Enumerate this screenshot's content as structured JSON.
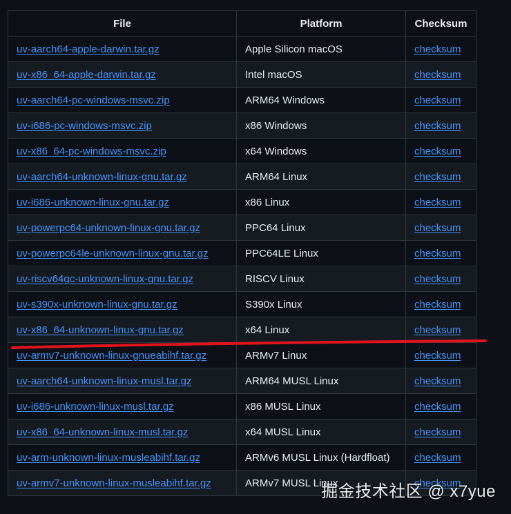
{
  "headers": {
    "file": "File",
    "platform": "Platform",
    "checksum": "Checksum"
  },
  "rows": [
    {
      "file": "uv-aarch64-apple-darwin.tar.gz",
      "platform": "Apple Silicon macOS",
      "checksum": "checksum"
    },
    {
      "file": "uv-x86_64-apple-darwin.tar.gz",
      "platform": "Intel macOS",
      "checksum": "checksum"
    },
    {
      "file": "uv-aarch64-pc-windows-msvc.zip",
      "platform": "ARM64 Windows",
      "checksum": "checksum"
    },
    {
      "file": "uv-i686-pc-windows-msvc.zip",
      "platform": "x86 Windows",
      "checksum": "checksum"
    },
    {
      "file": "uv-x86_64-pc-windows-msvc.zip",
      "platform": "x64 Windows",
      "checksum": "checksum"
    },
    {
      "file": "uv-aarch64-unknown-linux-gnu.tar.gz",
      "platform": "ARM64 Linux",
      "checksum": "checksum"
    },
    {
      "file": "uv-i686-unknown-linux-gnu.tar.gz",
      "platform": "x86 Linux",
      "checksum": "checksum"
    },
    {
      "file": "uv-powerpc64-unknown-linux-gnu.tar.gz",
      "platform": "PPC64 Linux",
      "checksum": "checksum"
    },
    {
      "file": "uv-powerpc64le-unknown-linux-gnu.tar.gz",
      "platform": "PPC64LE Linux",
      "checksum": "checksum"
    },
    {
      "file": "uv-riscv64gc-unknown-linux-gnu.tar.gz",
      "platform": "RISCV Linux",
      "checksum": "checksum"
    },
    {
      "file": "uv-s390x-unknown-linux-gnu.tar.gz",
      "platform": "S390x Linux",
      "checksum": "checksum"
    },
    {
      "file": "uv-x86_64-unknown-linux-gnu.tar.gz",
      "platform": "x64 Linux",
      "checksum": "checksum"
    },
    {
      "file": "uv-armv7-unknown-linux-gnueabihf.tar.gz",
      "platform": "ARMv7 Linux",
      "checksum": "checksum"
    },
    {
      "file": "uv-aarch64-unknown-linux-musl.tar.gz",
      "platform": "ARM64 MUSL Linux",
      "checksum": "checksum"
    },
    {
      "file": "uv-i686-unknown-linux-musl.tar.gz",
      "platform": "x86 MUSL Linux",
      "checksum": "checksum"
    },
    {
      "file": "uv-x86_64-unknown-linux-musl.tar.gz",
      "platform": "x64 MUSL Linux",
      "checksum": "checksum"
    },
    {
      "file": "uv-arm-unknown-linux-musleabihf.tar.gz",
      "platform": "ARMv6 MUSL Linux (Hardfloat)",
      "checksum": "checksum"
    },
    {
      "file": "uv-armv7-unknown-linux-musleabihf.tar.gz",
      "platform": "ARMv7 MUSL Linux",
      "checksum": "checksum"
    }
  ],
  "annotation": {
    "color": "#e0141e"
  },
  "watermark": "掘金技术社区 @ x7yue",
  "colors": {
    "background": "#0d1117",
    "link": "#4493f8",
    "text": "#e6edf3",
    "border": "#30363d"
  }
}
